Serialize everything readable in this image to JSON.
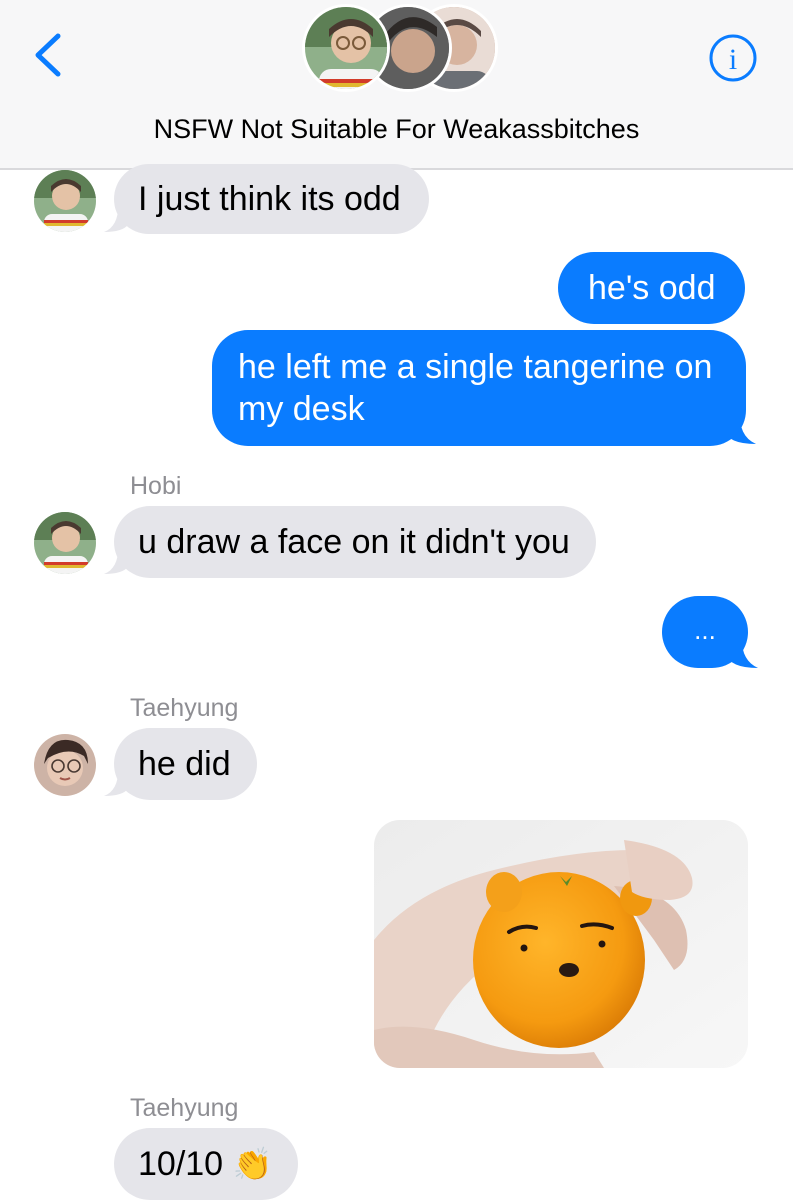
{
  "header": {
    "title": "NSFW Not Suitable For Weakassbitches",
    "back_icon": "chevron-left-icon",
    "info_icon": "info-icon",
    "accent": "#0a7cff"
  },
  "messages": [
    {
      "type": "received",
      "text": "I just think its odd"
    },
    {
      "type": "sent",
      "text": "he's odd"
    },
    {
      "type": "sent",
      "text_line1": "he left me a single tangerine on",
      "text_line2": "my desk"
    },
    {
      "type": "received",
      "sender": "Hobi",
      "text": "u draw a face on it didn't you"
    },
    {
      "type": "sent",
      "text": "..."
    },
    {
      "type": "received",
      "sender": "Taehyung",
      "text": "he did"
    },
    {
      "type": "sent_image",
      "image": "tangerine-bear-face-photo"
    },
    {
      "type": "received",
      "sender": "Taehyung",
      "text": "10/10",
      "emoji": "👏"
    }
  ],
  "colors": {
    "sent_bubble": "#0a7cff",
    "received_bubble": "#e5e5ea",
    "sender_name": "#8e8e93"
  }
}
